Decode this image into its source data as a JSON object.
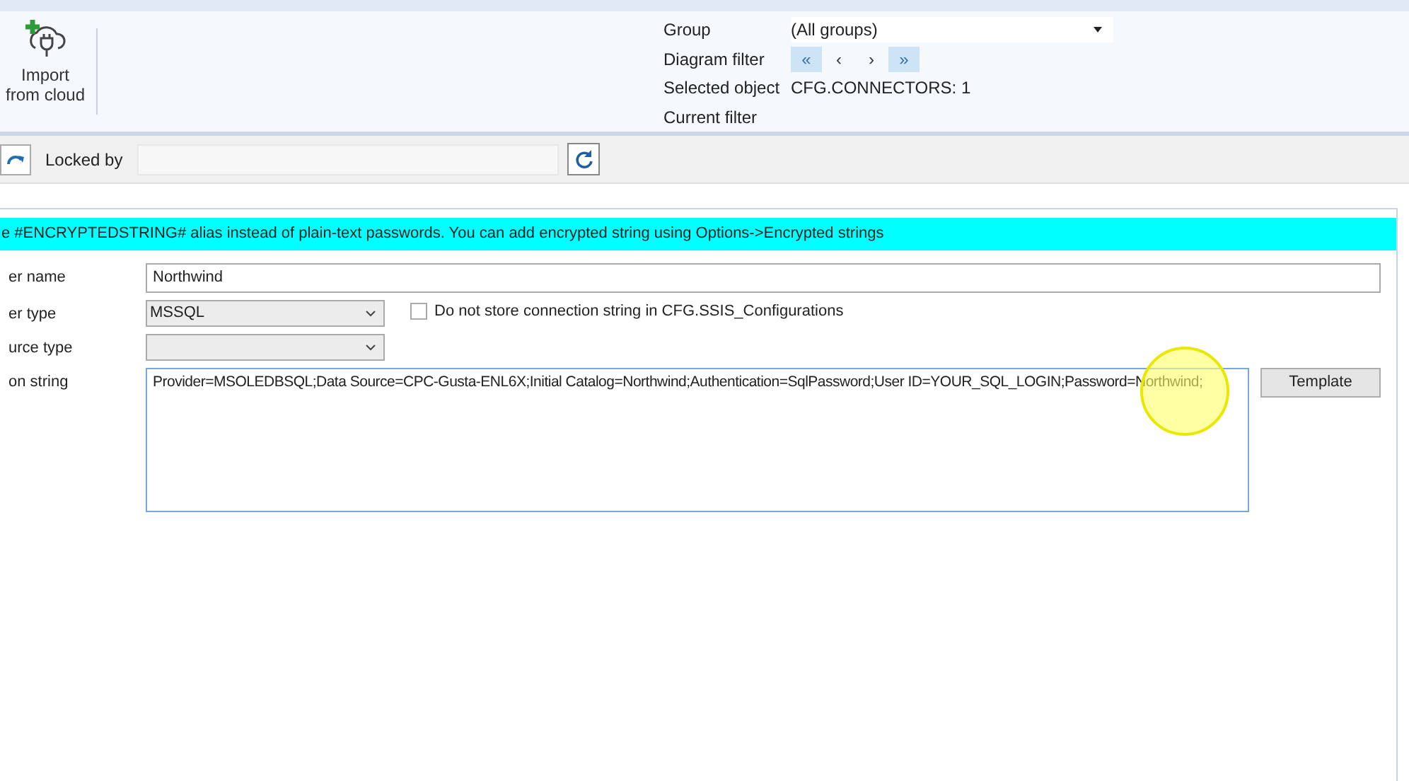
{
  "ribbon": {
    "import_button": {
      "label_lines": [
        "Import",
        "from cloud"
      ]
    },
    "fields": [
      {
        "kind": "select",
        "label": "Group",
        "value": "(All groups)"
      },
      {
        "kind": "nav",
        "label": "Diagram filter",
        "buttons": [
          {
            "label": "«",
            "selected": true
          },
          {
            "label": "‹",
            "selected": false
          },
          {
            "label": "›",
            "selected": false
          },
          {
            "label": "»",
            "selected": true
          }
        ]
      },
      {
        "kind": "text",
        "label": "Selected object",
        "value": "CFG.CONNECTORS: 1"
      },
      {
        "kind": "text",
        "label": "Current filter"
      }
    ]
  },
  "toolbar": {
    "locked_by_label": "Locked by"
  },
  "banner": "e #ENCRYPTEDSTRING# alias instead of plain-text passwords. You can add encrypted string using Options->Encrypted strings",
  "form": [
    {
      "kind": "text",
      "label": "er name",
      "value": "Northwind"
    },
    {
      "kind": "select",
      "label": "er type",
      "value": "MSSQL",
      "checkbox": {
        "label": "Do not store connection string in CFG.SSIS_Configurations",
        "checked": false
      }
    },
    {
      "kind": "select",
      "label": "urce type"
    },
    {
      "kind": "textarea",
      "label": "on string",
      "value": "Provider=MSOLEDBSQL;Data Source=CPC-Gusta-ENL6X;Initial Catalog=Northwind;Authentication=SqlPassword;User ID=YOUR_SQL_LOGIN;Password=Northwind;",
      "button": "Template"
    }
  ]
}
